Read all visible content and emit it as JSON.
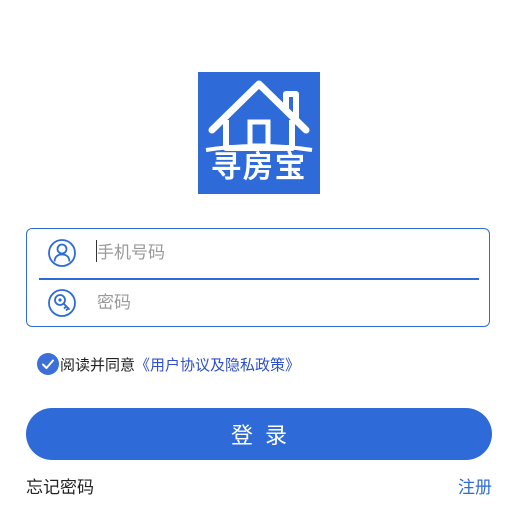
{
  "app": {
    "logo_text": "寻房宝",
    "brand_color": "#2e6bd9"
  },
  "login_form": {
    "phone": {
      "placeholder": "手机号码",
      "value": "",
      "icon": "user-icon"
    },
    "password": {
      "placeholder": "密码",
      "value": "",
      "icon": "key-icon"
    }
  },
  "agreement": {
    "checked": true,
    "text": "阅读并同意",
    "link_text": "《用户协议及隐私政策》",
    "link_color": "#2d4fcc"
  },
  "actions": {
    "login_label": "登录",
    "forgot_label": "忘记密码",
    "register_label": "注册"
  }
}
